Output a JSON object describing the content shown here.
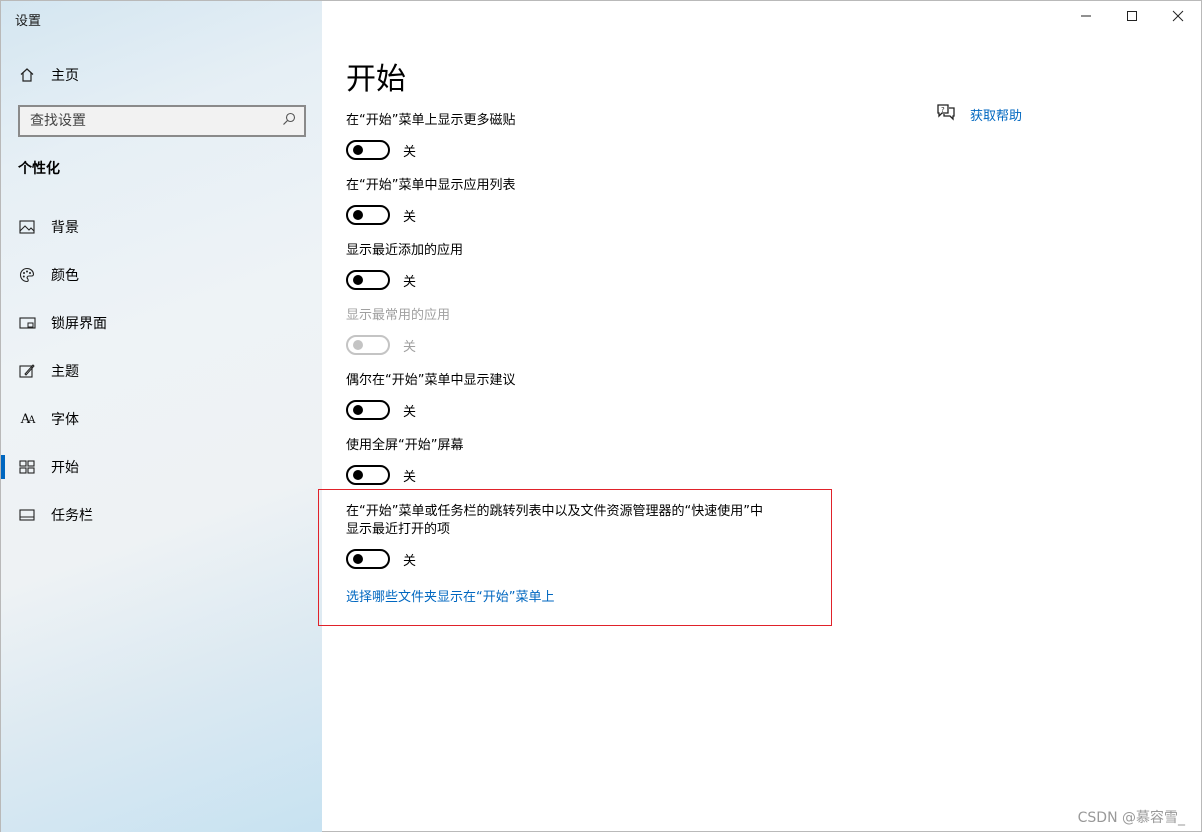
{
  "window": {
    "title": "设置",
    "controls": [
      "minimize",
      "maximize",
      "close"
    ]
  },
  "sidebar": {
    "home_label": "主页",
    "search_placeholder": "查找设置",
    "section_title": "个性化",
    "items": [
      {
        "label": "背景",
        "icon": "image-icon",
        "active": false
      },
      {
        "label": "颜色",
        "icon": "palette-icon",
        "active": false
      },
      {
        "label": "锁屏界面",
        "icon": "lock-screen-icon",
        "active": false
      },
      {
        "label": "主题",
        "icon": "theme-icon",
        "active": false
      },
      {
        "label": "字体",
        "icon": "font-icon",
        "active": false
      },
      {
        "label": "开始",
        "icon": "start-icon",
        "active": true
      },
      {
        "label": "任务栏",
        "icon": "taskbar-icon",
        "active": false
      }
    ]
  },
  "main": {
    "title": "开始",
    "help_label": "获取帮助",
    "settings": [
      {
        "title": "在“开始”菜单上显示更多磁贴",
        "state": "关",
        "enabled": true,
        "on": false
      },
      {
        "title": "在“开始”菜单中显示应用列表",
        "state": "关",
        "enabled": true,
        "on": false
      },
      {
        "title": "显示最近添加的应用",
        "state": "关",
        "enabled": true,
        "on": false
      },
      {
        "title": "显示最常用的应用",
        "state": "关",
        "enabled": false,
        "on": false
      },
      {
        "title": "偶尔在“开始”菜单中显示建议",
        "state": "关",
        "enabled": true,
        "on": false
      },
      {
        "title": "使用全屏“开始”屏幕",
        "state": "关",
        "enabled": true,
        "on": false
      },
      {
        "title_line1": "在“开始”菜单或任务栏的跳转列表中以及文件资源管理器的“快速使用”中",
        "title_line2": "显示最近打开的项",
        "state": "关",
        "enabled": true,
        "on": false
      }
    ],
    "folders_link": "选择哪些文件夹显示在“开始”菜单上"
  },
  "watermark": "CSDN @慕容雪_",
  "colors": {
    "accent": "#0067c0",
    "highlight_border": "#e0222a"
  }
}
